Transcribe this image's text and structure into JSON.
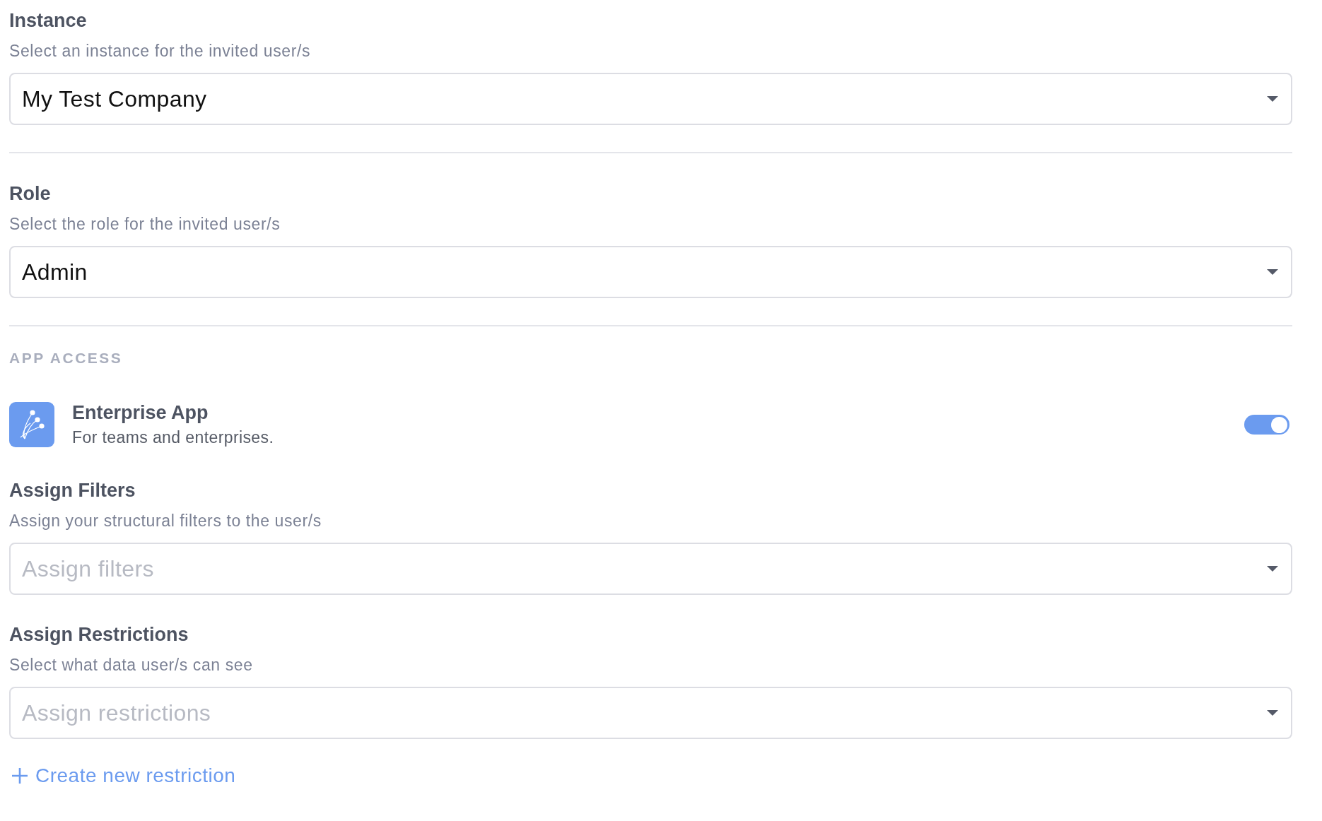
{
  "fields": [
    {
      "title": "Instance",
      "description": "Select an instance for the invited user/s",
      "value": "My Test Company"
    },
    {
      "title": "Role",
      "description": "Select the role for the invited user/s",
      "value": "Admin"
    }
  ],
  "app_access": {
    "heading": "APP ACCESS",
    "apps": [
      {
        "name": "Enterprise App",
        "description": "For teams and enterprises.",
        "on": true
      }
    ],
    "fields": [
      {
        "title": "Assign Filters",
        "description": "Assign your structural filters to the user/s",
        "placeholder": "Assign filters"
      },
      {
        "title": "Assign Restrictions",
        "description": "Select what data user/s can see",
        "placeholder": "Assign restrictions"
      }
    ],
    "link": "Create new restriction"
  }
}
